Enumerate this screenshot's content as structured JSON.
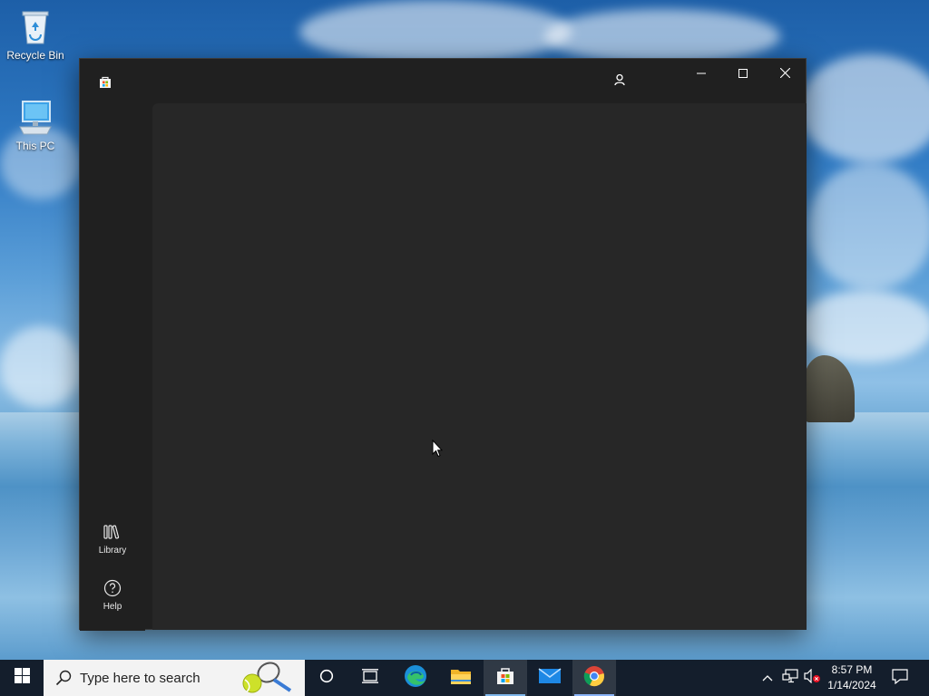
{
  "desktop": {
    "icons": [
      {
        "label": "Recycle Bin",
        "icon": "recycle-bin-icon"
      },
      {
        "label": "This PC",
        "icon": "computer-icon"
      }
    ]
  },
  "window": {
    "app_icon": "microsoft-store-icon",
    "account_icon": "user-account-icon",
    "controls": {
      "minimize": "minimize-icon",
      "maximize": "maximize-icon",
      "close": "close-icon"
    },
    "nav": {
      "library_label": "Library",
      "help_label": "Help"
    }
  },
  "taskbar": {
    "search_placeholder": "Type here to search",
    "apps": [
      {
        "name": "cortana",
        "icon": "cortana-circle-icon"
      },
      {
        "name": "task-view",
        "icon": "task-view-icon"
      },
      {
        "name": "edge",
        "icon": "edge-icon"
      },
      {
        "name": "file-explorer",
        "icon": "folder-icon"
      },
      {
        "name": "microsoft-store",
        "icon": "store-icon",
        "active": true
      },
      {
        "name": "mail",
        "icon": "mail-icon"
      },
      {
        "name": "chrome",
        "icon": "chrome-icon"
      }
    ],
    "clock": {
      "time": "8:57 PM",
      "date": "1/14/2024"
    }
  },
  "colors": {
    "window_bg": "#202020",
    "content_bg": "#272727",
    "taskbar_bg": "#101824",
    "search_bg": "#f3f3f3",
    "active_indicator": "#7fb8ec"
  }
}
